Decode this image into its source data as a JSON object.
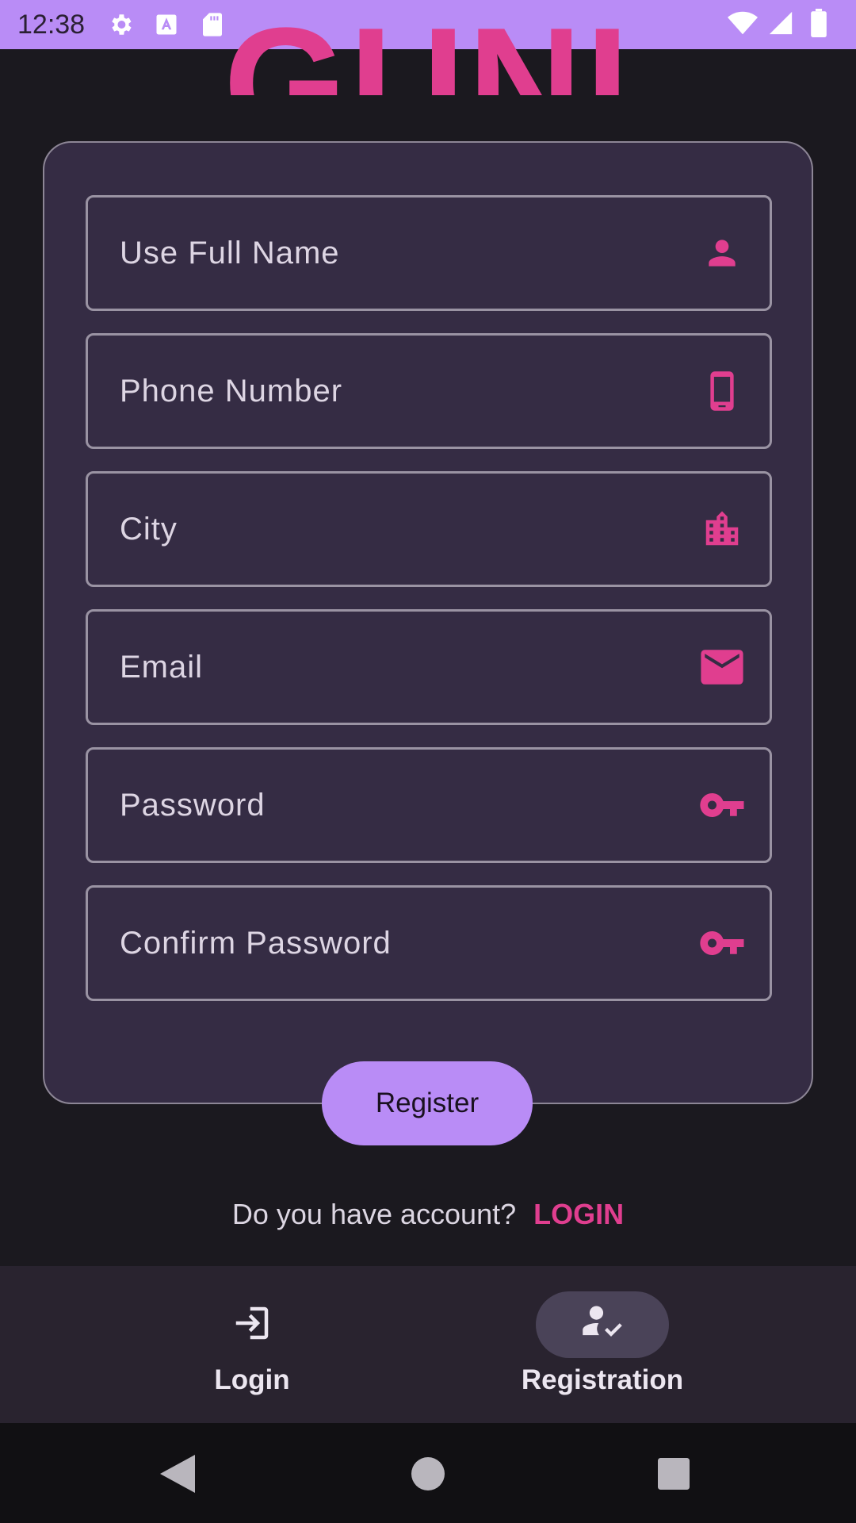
{
  "status_bar": {
    "time": "12:38",
    "icons": [
      "gear-icon",
      "font-icon",
      "sd-card-icon",
      "wifi-icon",
      "signal-icon",
      "battery-icon"
    ]
  },
  "logo": {
    "text": "GUNI",
    "color": "#e03e8f"
  },
  "form": {
    "fields": [
      {
        "placeholder": "Use Full Name",
        "icon": "person-icon"
      },
      {
        "placeholder": "Phone Number",
        "icon": "phone-icon"
      },
      {
        "placeholder": "City",
        "icon": "city-icon"
      },
      {
        "placeholder": "Email",
        "icon": "mail-icon"
      },
      {
        "placeholder": "Password",
        "icon": "key-icon"
      },
      {
        "placeholder": "Confirm Password",
        "icon": "key-icon"
      }
    ],
    "register_label": "Register"
  },
  "account_prompt": {
    "text": "Do you have account?",
    "link_label": "LOGIN"
  },
  "bottom_nav": {
    "items": [
      {
        "label": "Login",
        "icon": "login-icon",
        "active": false
      },
      {
        "label": "Registration",
        "icon": "person-check-icon",
        "active": true
      }
    ]
  },
  "colors": {
    "accent": "#e03e8f",
    "primary": "#b98cf6",
    "background": "#1b191f",
    "card": "#352c44"
  }
}
